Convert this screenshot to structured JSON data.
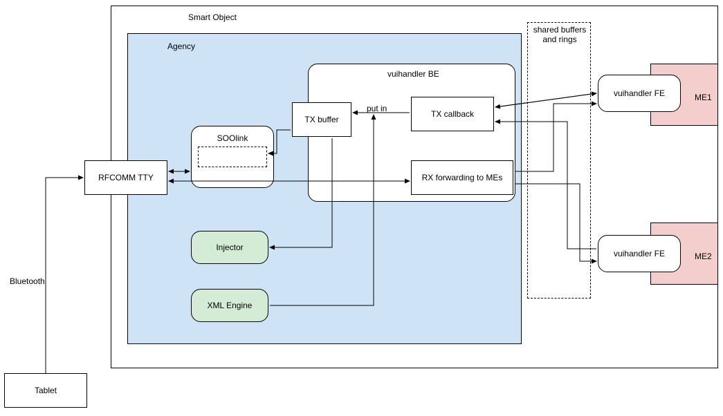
{
  "outer": {
    "smartObject": "Smart Object",
    "agency": "Agency",
    "sharedBuffers": "shared buffers\nand rings",
    "vuihandlerBE": "vuihandler BE"
  },
  "nodes": {
    "tablet": "Tablet",
    "rfcomm": "RFCOMM TTY",
    "soolink": "SOOlink",
    "txBuffer": "TX buffer",
    "txCallback": "TX callback",
    "rxForward": "RX forwarding to MEs",
    "injector": "Injector",
    "xmlEngine": "XML Engine",
    "vuihandlerFE1": "vuihandler FE",
    "vuihandlerFE2": "vuihandler FE",
    "me1": "ME1",
    "me2": "ME2"
  },
  "edges": {
    "bluetooth": "Bluetooth",
    "putIn": "put in"
  },
  "colors": {
    "agencyFill": "#cfe3f6",
    "greenFill": "#d4ecd5",
    "redFill": "#f4cecc"
  }
}
